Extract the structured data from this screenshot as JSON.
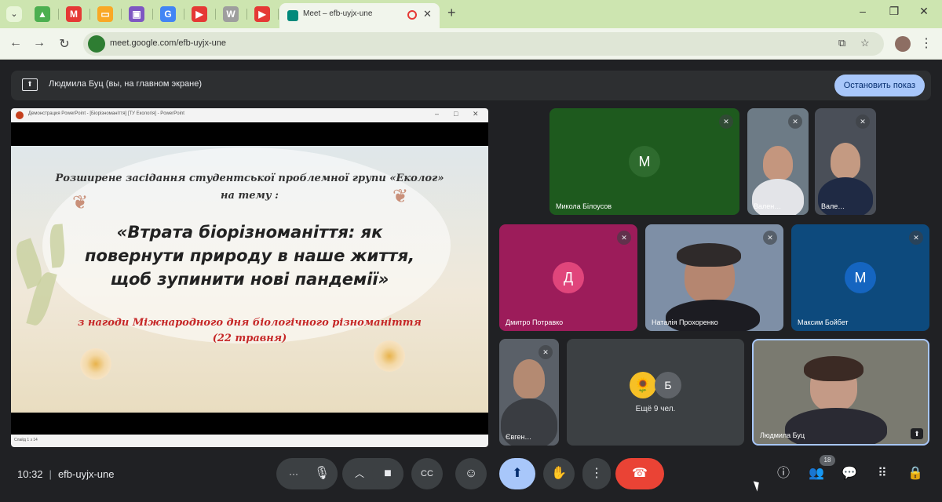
{
  "browser": {
    "active_tab_title": "Meet – efb-uyjx-une",
    "active_tab_close": "✕",
    "new_tab": "+",
    "url": "meet.google.com/efb-uyjx-une",
    "nav": {
      "back": "←",
      "forward": "→",
      "reload": "↻"
    },
    "window": {
      "minimize": "–",
      "maximize": "❐",
      "close": "✕"
    },
    "pinned_tabs": [
      {
        "icon": "drive-icon",
        "glyph": "▲",
        "color": "#4caf50"
      },
      {
        "icon": "gmail-icon",
        "glyph": "M",
        "color": "#e53935"
      },
      {
        "icon": "slides-icon",
        "glyph": "▭",
        "color": "#f9a825"
      },
      {
        "icon": "classroom-icon",
        "glyph": "▣",
        "color": "#7e57c2"
      },
      {
        "icon": "google-icon",
        "glyph": "G",
        "color": "#4285f4"
      },
      {
        "icon": "youtube-icon",
        "glyph": "▶",
        "color": "#e53935"
      },
      {
        "icon": "wikipedia-icon",
        "glyph": "W",
        "color": "#9e9e9e"
      },
      {
        "icon": "youtube-icon",
        "glyph": "▶",
        "color": "#e53935"
      }
    ]
  },
  "banner": {
    "text": "Людмила Буц (вы, на главном экране)",
    "stop_button": "Остановить показ"
  },
  "presentation": {
    "window_title": "Демонстрация PowerPoint - [Біорізноманіття] [ТУ Екологія] - PowerPoint",
    "status_text": "Слайд 1 з 14",
    "slide": {
      "subtitle_line1": "Розширене засідання студентської  проблемної групи «Еколог»",
      "subtitle_line2": "на тему :",
      "title_line1": "«Втрата біорізноманіття: як",
      "title_line2": "повернути природу в наше життя,",
      "title_line3": "щоб зупинити нові пандемії»",
      "occasion_line1": "з нагоди Міжнародного дня біологічного  різноманіття",
      "occasion_line2": "(22 травня)"
    }
  },
  "participants": [
    {
      "name": "Микола Білоусов",
      "initial": "М",
      "color": "#1e5a1e"
    },
    {
      "name": "Вален…",
      "initial": "",
      "color": "#6d7b86"
    },
    {
      "name": "Вале…",
      "initial": "",
      "color": "#4a4f58"
    },
    {
      "name": "Дмитро Потравко",
      "initial": "Д",
      "color": "#9c1c5a"
    },
    {
      "name": "Наталія Прохоренко",
      "initial": "",
      "color": "#7e8fa6"
    },
    {
      "name": "Максим Бойбет",
      "initial": "М",
      "color": "#0d4a7d"
    },
    {
      "name": "Євген…",
      "initial": "",
      "color": "#5a6068"
    },
    {
      "name": "Людмила Буц",
      "initial": "",
      "color": "#7a7a70"
    }
  ],
  "others_tile": {
    "avatar_initial": "Б",
    "text": "Ещё 9 чел."
  },
  "meeting": {
    "time": "10:32",
    "separator": "|",
    "code": "efb-uyjx-une",
    "participant_count": "18"
  },
  "controls": {
    "more_audio": "···",
    "mic": "🎙",
    "more_video": "︿",
    "camera": "■",
    "captions": "CC",
    "emoji": "☺",
    "present": "⬆",
    "hand": "✋",
    "more": "⋮",
    "hangup": "☎",
    "info": "ⓘ",
    "people": "👥",
    "chat": "💬",
    "activities": "⠿",
    "lock": "🔒"
  }
}
